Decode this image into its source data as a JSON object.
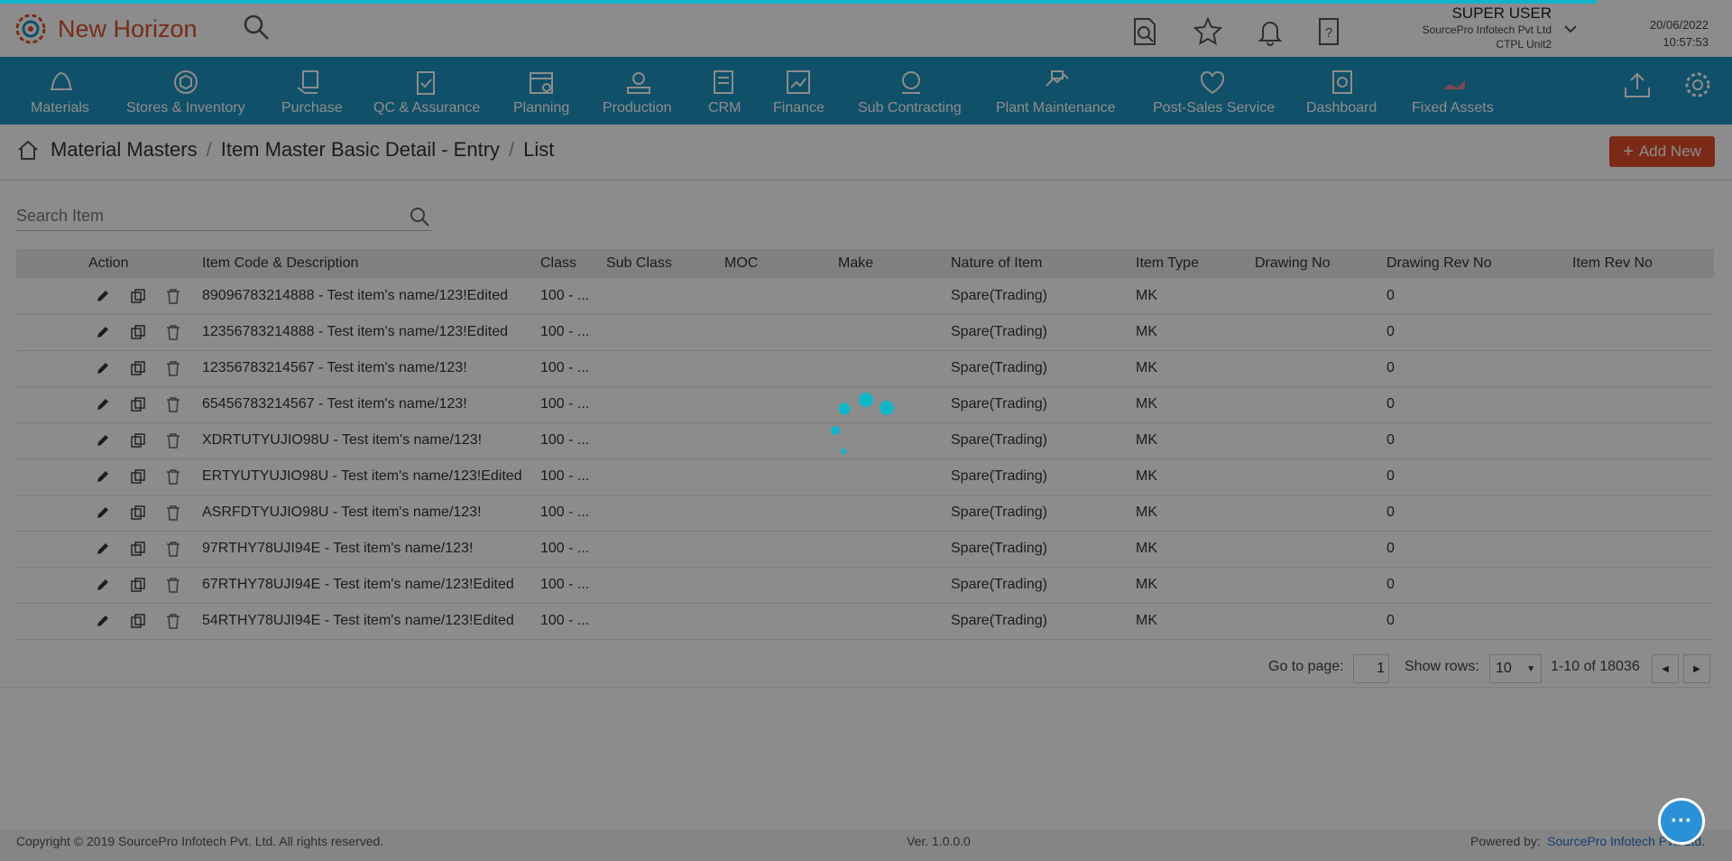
{
  "app": {
    "name": "New Horizon"
  },
  "user": {
    "name": "SUPER USER",
    "org": "SourcePro Infotech Pvt Ltd",
    "unit": "CTPL Unit2"
  },
  "datetime": {
    "date": "20/06/2022",
    "time": "10:57:53"
  },
  "nav": {
    "items": [
      {
        "label": "Materials",
        "icon": "materials-icon"
      },
      {
        "label": "Stores & Inventory",
        "icon": "stores-icon"
      },
      {
        "label": "Purchase",
        "icon": "purchase-icon"
      },
      {
        "label": "QC & Assurance",
        "icon": "qc-icon"
      },
      {
        "label": "Planning",
        "icon": "planning-icon"
      },
      {
        "label": "Production",
        "icon": "production-icon"
      },
      {
        "label": "CRM",
        "icon": "crm-icon"
      },
      {
        "label": "Finance",
        "icon": "finance-icon"
      },
      {
        "label": "Sub Contracting",
        "icon": "subcontracting-icon"
      },
      {
        "label": "Plant Maintenance",
        "icon": "maintenance-icon"
      },
      {
        "label": "Post-Sales Service",
        "icon": "service-icon"
      },
      {
        "label": "Dashboard",
        "icon": "dashboard-icon"
      },
      {
        "label": "Fixed Assets",
        "icon": "assets-icon"
      }
    ]
  },
  "breadcrumb": [
    "Material Masters",
    "Item Master Basic Detail - Entry",
    "List"
  ],
  "add_new_label": "Add New",
  "search": {
    "placeholder": "Search Item"
  },
  "table": {
    "headers": [
      "Action",
      "Item Code & Description",
      "Class",
      "Sub Class",
      "MOC",
      "Make",
      "Nature of Item",
      "Item Type",
      "Drawing No",
      "Drawing Rev No",
      "Item Rev No"
    ],
    "rows": [
      {
        "desc": "89096783214888 - Test item's name/123!Edited",
        "class": "100 - ...",
        "nature": "Spare(Trading)",
        "type": "MK",
        "drev": "0"
      },
      {
        "desc": "12356783214888 - Test item's name/123!Edited",
        "class": "100 - ...",
        "nature": "Spare(Trading)",
        "type": "MK",
        "drev": "0"
      },
      {
        "desc": "12356783214567 - Test item's name/123!",
        "class": "100 - ...",
        "nature": "Spare(Trading)",
        "type": "MK",
        "drev": "0"
      },
      {
        "desc": "65456783214567 - Test item's name/123!",
        "class": "100 - ...",
        "nature": "Spare(Trading)",
        "type": "MK",
        "drev": "0"
      },
      {
        "desc": "XDRTUTYUJIO98U - Test item's name/123!",
        "class": "100 - ...",
        "nature": "Spare(Trading)",
        "type": "MK",
        "drev": "0"
      },
      {
        "desc": "ERTYUTYUJIO98U - Test item's name/123!Edited",
        "class": "100 - ...",
        "nature": "Spare(Trading)",
        "type": "MK",
        "drev": "0"
      },
      {
        "desc": "ASRFDTYUJIO98U - Test item's name/123!",
        "class": "100 - ...",
        "nature": "Spare(Trading)",
        "type": "MK",
        "drev": "0"
      },
      {
        "desc": "97RTHY78UJI94E - Test item's name/123!",
        "class": "100 - ...",
        "nature": "Spare(Trading)",
        "type": "MK",
        "drev": "0"
      },
      {
        "desc": "67RTHY78UJI94E - Test item's name/123!Edited",
        "class": "100 - ...",
        "nature": "Spare(Trading)",
        "type": "MK",
        "drev": "0"
      },
      {
        "desc": "54RTHY78UJI94E - Test item's name/123!Edited",
        "class": "100 - ...",
        "nature": "Spare(Trading)",
        "type": "MK",
        "drev": "0"
      }
    ]
  },
  "pager": {
    "goto_label": "Go to page:",
    "page": "1",
    "rows_label": "Show rows:",
    "rows": "10",
    "range": "1-10 of 18036"
  },
  "footer": {
    "copyright": "Copyright © 2019 SourcePro Infotech Pvt. Ltd. All rights reserved.",
    "version": "Ver. 1.0.0.0",
    "powered_label": "Powered by:",
    "powered_by": "SourcePro Infotech Pvt. Ltd."
  },
  "colors": {
    "accent": "#1f93c0",
    "brand": "#d9532c",
    "spinner": "#10b5c9"
  }
}
